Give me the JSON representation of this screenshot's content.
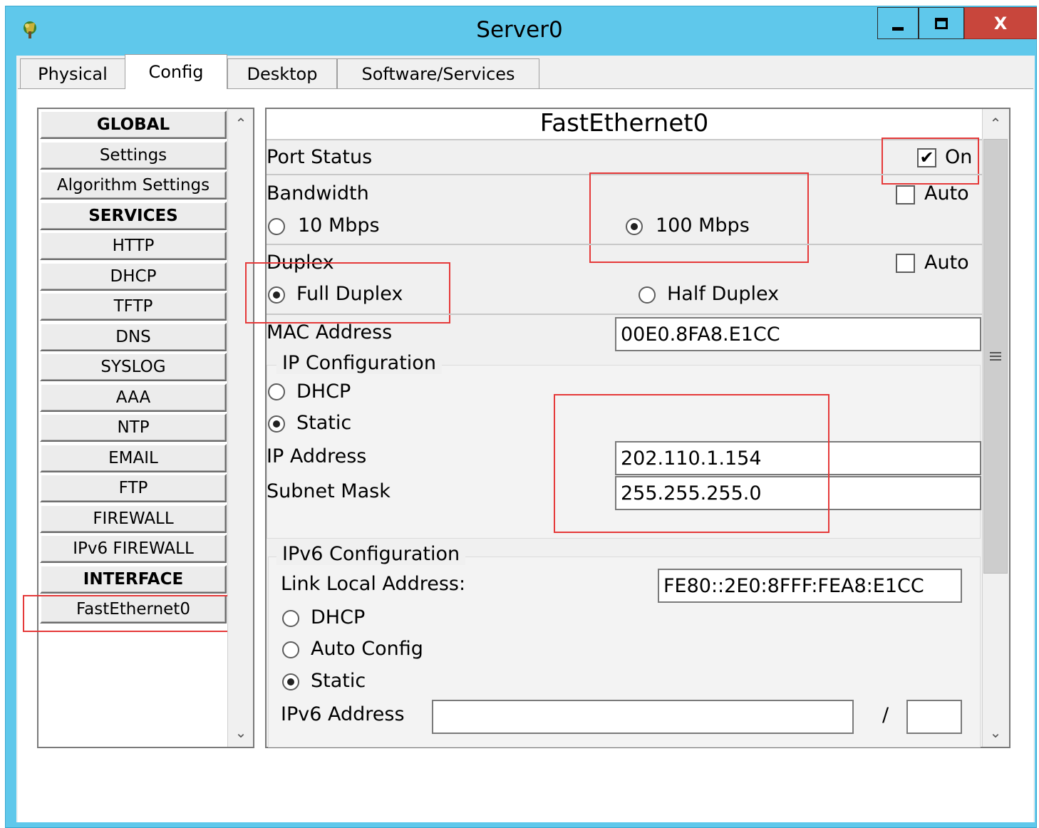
{
  "window": {
    "title": "Server0",
    "close_glyph": "X",
    "colors": {
      "titlebar": "#5fc8eb",
      "close": "#c8463c",
      "highlight": "#e53939"
    }
  },
  "tabs": [
    {
      "label": "Physical",
      "active": false
    },
    {
      "label": "Config",
      "active": true
    },
    {
      "label": "Desktop",
      "active": false
    },
    {
      "label": "Software/Services",
      "active": false
    }
  ],
  "sidebar": {
    "items": [
      {
        "label": "GLOBAL",
        "header": true
      },
      {
        "label": "Settings"
      },
      {
        "label": "Algorithm Settings"
      },
      {
        "label": "SERVICES",
        "header": true
      },
      {
        "label": "HTTP"
      },
      {
        "label": "DHCP"
      },
      {
        "label": "TFTP"
      },
      {
        "label": "DNS"
      },
      {
        "label": "SYSLOG"
      },
      {
        "label": "AAA"
      },
      {
        "label": "NTP"
      },
      {
        "label": "EMAIL"
      },
      {
        "label": "FTP"
      },
      {
        "label": "FIREWALL"
      },
      {
        "label": "IPv6 FIREWALL"
      },
      {
        "label": "INTERFACE",
        "header": true
      },
      {
        "label": "FastEthernet0",
        "selected": true
      }
    ]
  },
  "interface": {
    "title": "FastEthernet0",
    "port_status": {
      "label": "Port Status",
      "on_label": "On",
      "on_checked": true,
      "check_glyph": "✔"
    },
    "bandwidth": {
      "label": "Bandwidth",
      "auto_label": "Auto",
      "auto_checked": false,
      "opt_10": "10 Mbps",
      "opt_100": "100 Mbps",
      "selected": "100 Mbps"
    },
    "duplex": {
      "label": "Duplex",
      "auto_label": "Auto",
      "auto_checked": false,
      "opt_full": "Full Duplex",
      "opt_half": "Half Duplex",
      "selected": "Full Duplex"
    },
    "mac": {
      "label": "MAC Address",
      "value": "00E0.8FA8.E1CC"
    },
    "ip_config": {
      "legend": "IP Configuration",
      "opt_dhcp": "DHCP",
      "opt_static": "Static",
      "selected": "Static",
      "ip_label": "IP Address",
      "ip_value": "202.110.1.154",
      "mask_label": "Subnet Mask",
      "mask_value": "255.255.255.0"
    },
    "ipv6_config": {
      "legend": "IPv6 Configuration",
      "link_local_label": "Link Local Address:",
      "link_local_value": "FE80::2E0:8FFF:FEA8:E1CC",
      "opt_dhcp": "DHCP",
      "opt_auto": "Auto Config",
      "opt_static": "Static",
      "selected": "Static",
      "address_label": "IPv6 Address",
      "address_value": "",
      "slash": "/",
      "prefix_value": ""
    }
  }
}
